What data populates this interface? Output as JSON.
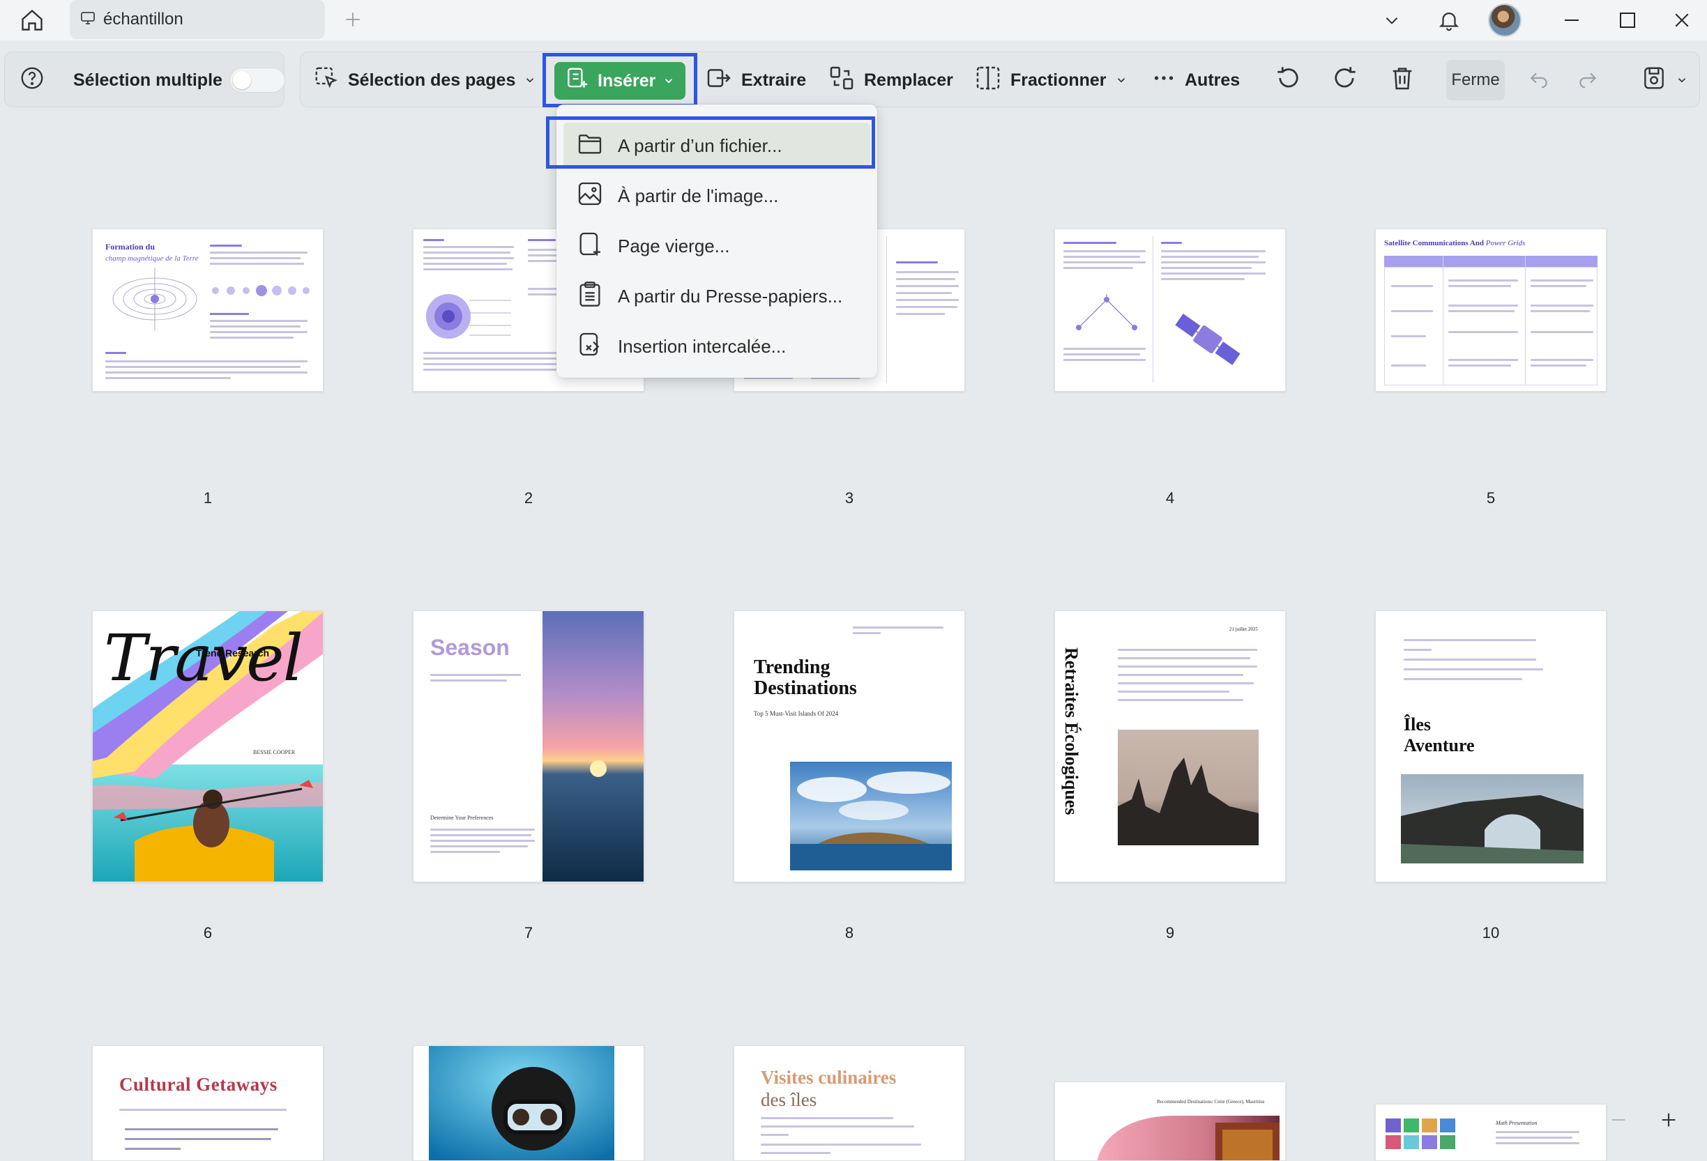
{
  "titlebar": {
    "tab_title": "échantillon",
    "icons": [
      "home-icon",
      "monitor-icon",
      "plus-icon",
      "chevron-down-icon",
      "bell-icon",
      "avatar",
      "minimize-icon",
      "maximize-icon",
      "close-icon"
    ]
  },
  "toolbar": {
    "help_icon": "question-icon",
    "multi_select_label": "Sélection multiple",
    "multi_select_on": false,
    "select_pages_label": "Sélection des pages",
    "insert_label": "Insérer",
    "extract_label": "Extraire",
    "replace_label": "Remplacer",
    "split_label": "Fractionner",
    "more_label": "Autres",
    "close_label": "Ferme"
  },
  "insert_menu": {
    "items": [
      {
        "label": "A partir d’un fichier...",
        "icon": "folder-icon"
      },
      {
        "label": "À partir de l'image...",
        "icon": "image-icon"
      },
      {
        "label": "Page vierge...",
        "icon": "blank-page-icon"
      },
      {
        "label": "A partir du Presse-papiers...",
        "icon": "clipboard-icon"
      },
      {
        "label": "Insertion intercalée...",
        "icon": "interleave-icon"
      }
    ]
  },
  "pages": {
    "numbers": [
      "1",
      "2",
      "3",
      "4",
      "5",
      "6",
      "7",
      "8",
      "9",
      "10"
    ],
    "p1": {
      "title": "Formation du",
      "subtitle": "champ magnétique de la Terre"
    },
    "p5": {
      "title": "Satellite Communications And",
      "title_italic": "Power Grids"
    },
    "p6": {
      "script": "Travel",
      "label": "Trend Research",
      "author": "BESSIE COOPER"
    },
    "p7": {
      "title": "Season",
      "heading": "Determine Your Preferences"
    },
    "p8": {
      "title_line1": "Trending",
      "title_line2": "Destinations",
      "subtitle": "Top 5 Must-Visit Islands Of 2024"
    },
    "p9": {
      "vertical_title": "Retraites Écologiques",
      "date": "21 juillet 2025"
    },
    "p10": {
      "title_line1": "Îles",
      "title_line2": "Aventure"
    },
    "p11": {
      "title": "Cultural Getaways"
    },
    "p13": {
      "title_line1": "Visites culinaires",
      "title_line2": "des îles"
    },
    "p14": {
      "header": "Recommended Destinations: Crete (Greece), Mauritius"
    },
    "p15": {
      "header": "Math Presentation"
    }
  },
  "colors": {
    "accent_blue": "#2e55e6",
    "insert_green": "#3aa55c",
    "background": "#e6eaec"
  }
}
